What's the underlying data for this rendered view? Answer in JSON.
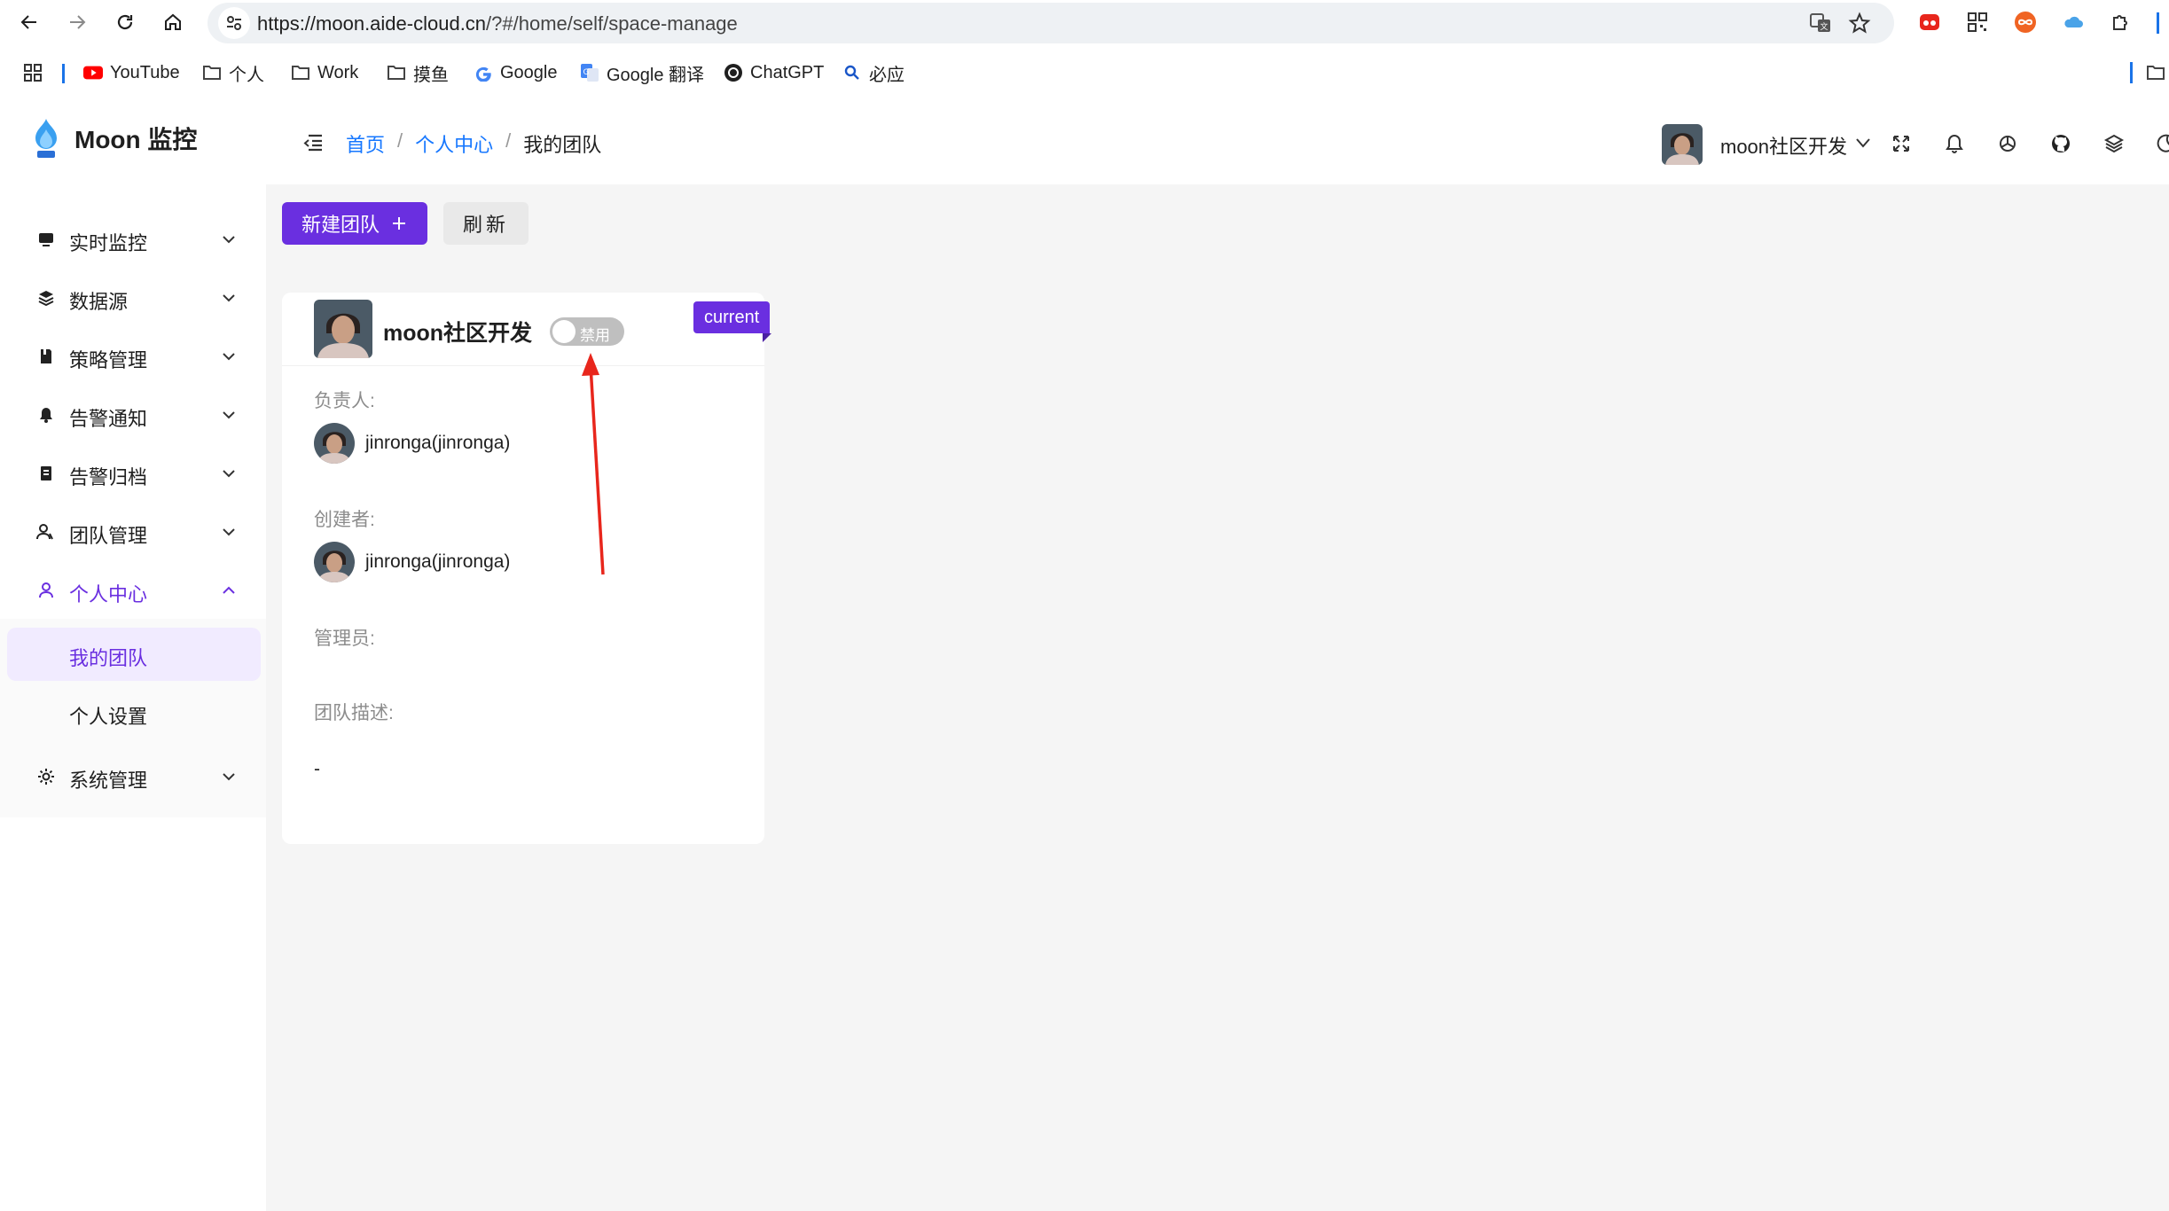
{
  "browser": {
    "url_host": "https://moon.aide-cloud.cn",
    "url_path": "/?#/home/self/space-manage",
    "bookmarks": [
      {
        "label": "YouTube",
        "icon": "youtube-icon"
      },
      {
        "label": "个人",
        "icon": "folder-icon"
      },
      {
        "label": "Work",
        "icon": "folder-icon"
      },
      {
        "label": "摸鱼",
        "icon": "folder-icon"
      },
      {
        "label": "Google",
        "icon": "google-icon"
      },
      {
        "label": "Google 翻译",
        "icon": "google-translate-icon"
      },
      {
        "label": "ChatGPT",
        "icon": "chatgpt-icon"
      },
      {
        "label": "必应",
        "icon": "search-icon"
      }
    ]
  },
  "app": {
    "logo_text": "Moon 监控"
  },
  "sidebar": {
    "items": [
      {
        "label": "实时监控",
        "icon": "monitor-icon"
      },
      {
        "label": "数据源",
        "icon": "layers-icon"
      },
      {
        "label": "策略管理",
        "icon": "book-icon"
      },
      {
        "label": "告警通知",
        "icon": "bell-icon"
      },
      {
        "label": "告警归档",
        "icon": "archive-icon"
      },
      {
        "label": "团队管理",
        "icon": "team-icon"
      },
      {
        "label": "个人中心",
        "icon": "user-icon"
      },
      {
        "label": "系统管理",
        "icon": "gear-icon"
      }
    ],
    "sub_items": [
      {
        "label": "我的团队"
      },
      {
        "label": "个人设置"
      }
    ]
  },
  "header": {
    "breadcrumb": {
      "home": "首页",
      "separator": "/",
      "section": "个人中心",
      "current": "我的团队"
    },
    "team_name": "moon社区开发"
  },
  "toolbar": {
    "new_team_label": "新建团队",
    "refresh_label": "刷新"
  },
  "team_card": {
    "name": "moon社区开发",
    "status_label": "禁用",
    "status_enabled": false,
    "ribbon": "current",
    "owner_label": "负责人:",
    "owner_name": "jinronga(jinronga)",
    "creator_label": "创建者:",
    "creator_name": "jinronga(jinronga)",
    "admin_label": "管理员:",
    "desc_label": "团队描述:",
    "desc_value": "-"
  },
  "colors": {
    "accent": "#6a2fe0",
    "link": "#1677ff",
    "annotation_arrow": "#e8261c"
  }
}
